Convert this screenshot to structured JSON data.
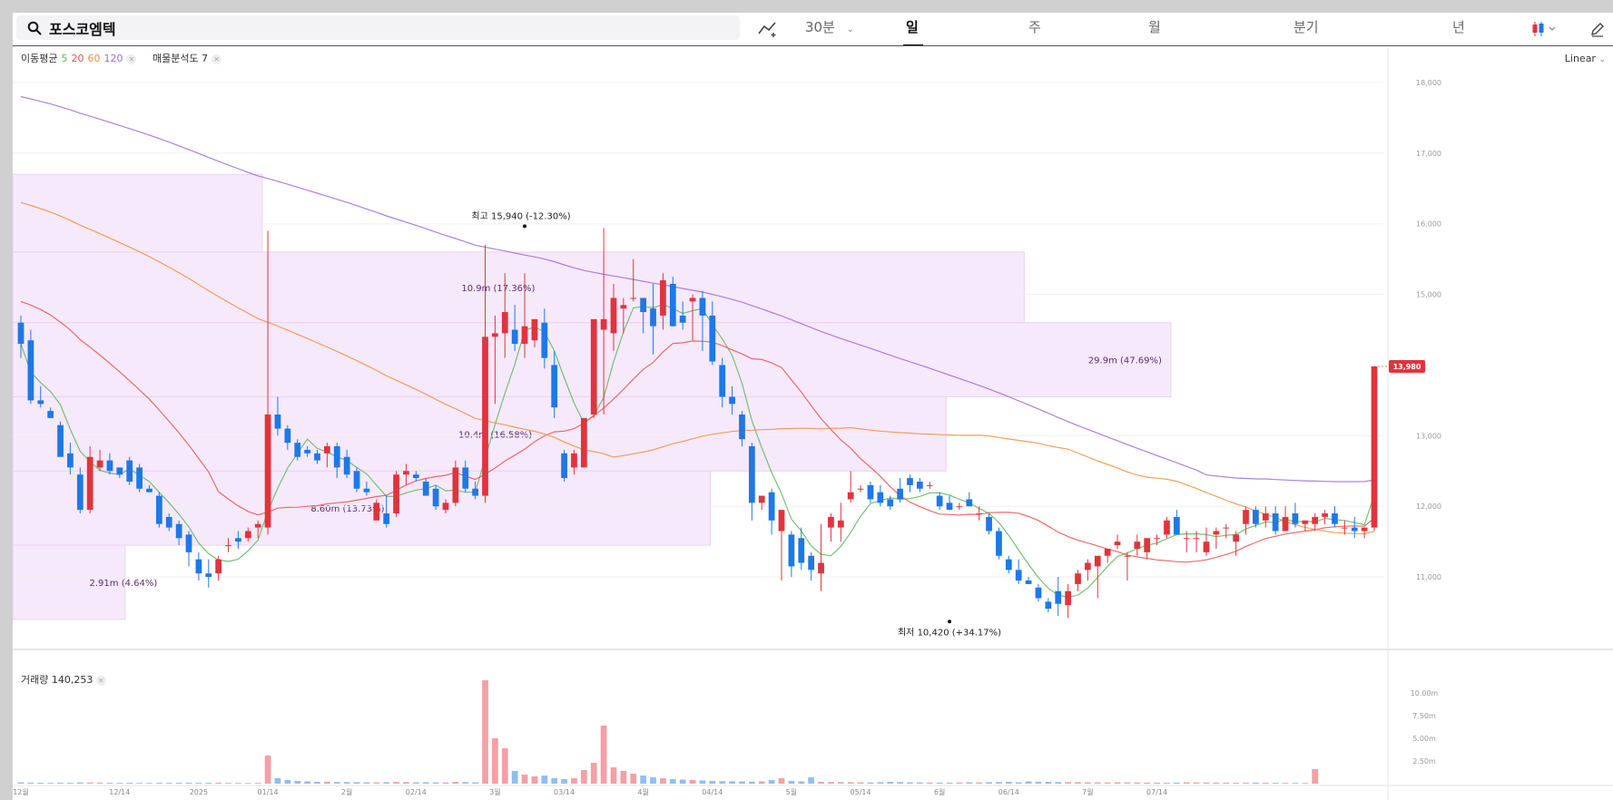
{
  "toolbar": {
    "search_value": "포스코엠텍",
    "interval": "30분",
    "tabs": [
      "일",
      "주",
      "월",
      "분기",
      "년"
    ],
    "active_tab": "일"
  },
  "legend": {
    "ma_label": "이동평균",
    "ma_periods": [
      {
        "label": "5",
        "color": "#5cb85c"
      },
      {
        "label": "20",
        "color": "#e9534f"
      },
      {
        "label": "60",
        "color": "#f0913e"
      },
      {
        "label": "120",
        "color": "#a06ad8"
      }
    ],
    "vp_label": "매물분석도 7",
    "volume_label": "거래량 140,253",
    "scale_mode": "Linear"
  },
  "colors": {
    "up": "#e0343d",
    "down": "#1e78e6",
    "vol_up": "#f4a0a5",
    "vol_down": "#8fbff2",
    "profile": "#f6e9fb"
  },
  "chart_data": {
    "type": "candlestick",
    "ylim": [
      10000,
      18500
    ],
    "y_ticks": [
      "18,000",
      "17,000",
      "16,000",
      "15,000",
      "13,000",
      "12,000",
      "11,000"
    ],
    "x_ticks": [
      "12월",
      "12/14",
      "2025",
      "01/14",
      "2월",
      "02/14",
      "3월",
      "03/14",
      "4월",
      "04/14",
      "5월",
      "05/14",
      "6월",
      "06/14",
      "7월",
      "07/14"
    ],
    "x_tick_index": [
      0,
      10,
      18,
      25,
      33,
      40,
      48,
      55,
      63,
      70,
      78,
      85,
      93,
      100,
      108,
      115
    ],
    "last_price_label": "13,980",
    "high_annotation": {
      "label": "최고 15,940 (-12.30%)",
      "index": 51,
      "value": 15940
    },
    "low_annotation": {
      "label": "최저 10,420 (+34.17%)",
      "index": 94,
      "value": 10420
    },
    "volume_ticks": [
      "10.00m",
      "7.50m",
      "5.00m",
      "2.50m"
    ],
    "volume_ylim": [
      0,
      12000000
    ],
    "ohlc": [
      [
        14600,
        14700,
        14100,
        14300
      ],
      [
        14350,
        14500,
        13450,
        13500
      ],
      [
        13500,
        13700,
        13400,
        13450
      ],
      [
        13350,
        13400,
        13300,
        13250
      ],
      [
        13150,
        13200,
        12850,
        12700
      ],
      [
        12750,
        12900,
        12450,
        12550
      ],
      [
        12450,
        12550,
        11900,
        11950
      ],
      [
        11950,
        12850,
        11900,
        12700
      ],
      [
        12550,
        12800,
        12500,
        12650
      ],
      [
        12650,
        12750,
        12450,
        12500
      ],
      [
        12550,
        12550,
        12400,
        12450
      ],
      [
        12650,
        12700,
        12300,
        12350
      ],
      [
        12550,
        12600,
        12200,
        12250
      ],
      [
        12250,
        12300,
        12200,
        12200
      ],
      [
        12150,
        12200,
        11700,
        11750
      ],
      [
        11850,
        11900,
        11650,
        11700
      ],
      [
        11750,
        11800,
        11450,
        11550
      ],
      [
        11600,
        11650,
        11150,
        11350
      ],
      [
        11250,
        11350,
        10950,
        11050
      ],
      [
        11050,
        11250,
        10850,
        11000
      ],
      [
        11050,
        11300,
        10950,
        11250
      ],
      [
        11450,
        11550,
        11350,
        11450
      ],
      [
        11550,
        11650,
        11400,
        11500
      ],
      [
        11550,
        11700,
        11500,
        11650
      ],
      [
        11700,
        11800,
        11550,
        11750
      ],
      [
        11700,
        15900,
        11600,
        13300
      ],
      [
        13300,
        13550,
        13000,
        13100
      ],
      [
        13100,
        13150,
        12800,
        12900
      ],
      [
        12900,
        12950,
        12650,
        12700
      ],
      [
        12800,
        12850,
        12700,
        12750
      ],
      [
        12750,
        12800,
        12600,
        12650
      ],
      [
        12750,
        12900,
        12550,
        12850
      ],
      [
        12850,
        12900,
        12400,
        12550
      ],
      [
        12700,
        12800,
        12400,
        12450
      ],
      [
        12500,
        12550,
        12200,
        12250
      ],
      [
        12250,
        12350,
        12150,
        12200
      ],
      [
        11800,
        12100,
        11800,
        12050
      ],
      [
        11900,
        12150,
        11700,
        11750
      ],
      [
        11900,
        12500,
        11850,
        12450
      ],
      [
        12450,
        12600,
        12300,
        12500
      ],
      [
        12450,
        12500,
        12350,
        12400
      ],
      [
        12350,
        12400,
        12150,
        12150
      ],
      [
        12250,
        12300,
        11950,
        12000
      ],
      [
        11950,
        12100,
        11900,
        12050
      ],
      [
        12050,
        12650,
        12000,
        12550
      ],
      [
        12550,
        12650,
        12200,
        12250
      ],
      [
        12250,
        12350,
        12100,
        12150
      ],
      [
        12150,
        15700,
        12050,
        14400
      ],
      [
        14400,
        14700,
        13450,
        14450
      ],
      [
        14450,
        15300,
        14100,
        14750
      ],
      [
        14500,
        14850,
        14200,
        14300
      ],
      [
        14300,
        15300,
        14100,
        14550
      ],
      [
        14350,
        14650,
        14250,
        14650
      ],
      [
        14600,
        14800,
        13950,
        14100
      ],
      [
        14000,
        14200,
        13250,
        13400
      ],
      [
        12750,
        12800,
        12350,
        12400
      ],
      [
        12550,
        12800,
        12450,
        12750
      ],
      [
        12550,
        13250,
        13200,
        13250
      ],
      [
        13300,
        14550,
        13250,
        14650
      ],
      [
        14500,
        15940,
        13300,
        14650
      ],
      [
        14450,
        15150,
        14200,
        14950
      ],
      [
        14800,
        14950,
        14450,
        14850
      ],
      [
        14950,
        15500,
        14900,
        14950
      ],
      [
        14950,
        14950,
        14450,
        14750
      ],
      [
        14800,
        15150,
        14150,
        14550
      ],
      [
        14700,
        15300,
        14500,
        15200
      ],
      [
        15150,
        15250,
        14550,
        14550
      ],
      [
        14700,
        14900,
        14500,
        14600
      ],
      [
        14900,
        15000,
        14350,
        14950
      ],
      [
        14950,
        15050,
        14200,
        14700
      ],
      [
        14700,
        14900,
        14000,
        14050
      ],
      [
        14000,
        14100,
        13400,
        13550
      ],
      [
        13550,
        13700,
        13300,
        13450
      ],
      [
        13300,
        13350,
        12850,
        12950
      ],
      [
        12850,
        12900,
        11800,
        12050
      ],
      [
        12050,
        12150,
        11950,
        12150
      ],
      [
        12200,
        12250,
        11600,
        11800
      ],
      [
        11650,
        11950,
        10950,
        11950
      ],
      [
        11600,
        11650,
        11000,
        11150
      ],
      [
        11550,
        11700,
        11100,
        11200
      ],
      [
        11300,
        11350,
        10950,
        11100
      ],
      [
        11050,
        11750,
        10800,
        11200
      ],
      [
        11700,
        11900,
        11500,
        11850
      ],
      [
        11700,
        12050,
        11500,
        11800
      ],
      [
        12100,
        12500,
        12050,
        12200
      ],
      [
        12250,
        12300,
        12200,
        12250
      ],
      [
        12300,
        12350,
        12050,
        12100
      ],
      [
        12200,
        12300,
        12000,
        12050
      ],
      [
        12100,
        12150,
        11950,
        12000
      ],
      [
        12250,
        12400,
        12050,
        12100
      ],
      [
        12400,
        12450,
        12200,
        12300
      ],
      [
        12350,
        12400,
        12200,
        12250
      ],
      [
        12300,
        12350,
        12250,
        12300
      ],
      [
        12150,
        12200,
        11950,
        12000
      ],
      [
        12050,
        12150,
        11950,
        11950
      ],
      [
        12000,
        12050,
        11950,
        12000
      ],
      [
        12100,
        12200,
        12000,
        12000
      ],
      [
        11900,
        12000,
        11800,
        11900
      ],
      [
        11850,
        11900,
        11600,
        11650
      ],
      [
        11650,
        11700,
        11250,
        11300
      ],
      [
        11250,
        11300,
        11050,
        11100
      ],
      [
        11100,
        11250,
        10900,
        10950
      ],
      [
        10950,
        11000,
        10900,
        10900
      ],
      [
        10850,
        10900,
        10650,
        10700
      ],
      [
        10650,
        10700,
        10500,
        10550
      ],
      [
        10800,
        11000,
        10450,
        10620
      ],
      [
        10600,
        10900,
        10420,
        10800
      ],
      [
        10900,
        11100,
        10800,
        11050
      ],
      [
        11100,
        11250,
        10950,
        11200
      ],
      [
        11150,
        11300,
        10700,
        11300
      ],
      [
        11300,
        11400,
        11200,
        11400
      ],
      [
        11450,
        11600,
        11400,
        11500
      ],
      [
        11300,
        11350,
        10950,
        11300
      ],
      [
        11400,
        11600,
        11300,
        11500
      ],
      [
        11350,
        11550,
        11250,
        11550
      ],
      [
        11550,
        11600,
        11450,
        11550
      ],
      [
        11600,
        11850,
        11550,
        11800
      ],
      [
        11850,
        11950,
        11600,
        11600
      ],
      [
        11550,
        11650,
        11350,
        11550
      ],
      [
        11550,
        11650,
        11350,
        11550
      ],
      [
        11350,
        11700,
        11300,
        11500
      ],
      [
        11600,
        11700,
        11400,
        11650
      ],
      [
        11700,
        11750,
        11550,
        11700
      ],
      [
        11500,
        11650,
        11300,
        11600
      ],
      [
        11750,
        12000,
        11600,
        11950
      ],
      [
        11950,
        12000,
        11700,
        11750
      ],
      [
        11800,
        12000,
        11700,
        11900
      ],
      [
        11900,
        12000,
        11600,
        11650
      ],
      [
        11650,
        12000,
        11650,
        11850
      ],
      [
        11900,
        12050,
        11700,
        11750
      ],
      [
        11750,
        11800,
        11650,
        11800
      ],
      [
        11750,
        11900,
        11650,
        11850
      ],
      [
        11850,
        11950,
        11750,
        11900
      ],
      [
        11900,
        12000,
        11700,
        11750
      ],
      [
        11700,
        11800,
        11600,
        11700
      ],
      [
        11700,
        11850,
        11550,
        11650
      ],
      [
        11650,
        11700,
        11550,
        11700
      ],
      [
        11700,
        13980,
        11650,
        13980
      ]
    ],
    "volume": [
      150000,
      120000,
      100000,
      90000,
      110000,
      95000,
      140000,
      130000,
      110000,
      95000,
      90000,
      100000,
      85000,
      80000,
      95000,
      90000,
      100000,
      110000,
      95000,
      100000,
      120000,
      90000,
      85000,
      80000,
      90000,
      3100000,
      600000,
      400000,
      300000,
      250000,
      200000,
      220000,
      180000,
      170000,
      160000,
      150000,
      140000,
      160000,
      190000,
      170000,
      150000,
      160000,
      140000,
      130000,
      200000,
      180000,
      150000,
      11400000,
      5000000,
      3900000,
      1400000,
      1000000,
      800000,
      900000,
      600000,
      500000,
      600000,
      1500000,
      2300000,
      6400000,
      1800000,
      1400000,
      1100000,
      900000,
      700000,
      600000,
      500000,
      450000,
      400000,
      350000,
      300000,
      280000,
      260000,
      240000,
      220000,
      250000,
      400000,
      600000,
      300000,
      250000,
      700000,
      200000,
      180000,
      170000,
      160000,
      150000,
      140000,
      160000,
      200000,
      180000,
      150000,
      140000,
      130000,
      120000,
      110000,
      130000,
      150000,
      140000,
      160000,
      180000,
      200000,
      150000,
      250000,
      220000,
      200000,
      180000,
      170000,
      160000,
      150000,
      140000,
      130000,
      150000,
      140000,
      130000,
      120000,
      110000,
      100000,
      120000,
      150000,
      140000,
      130000,
      120000,
      110000,
      100000,
      110000,
      120000,
      100000,
      95000,
      90000,
      85000,
      80000,
      1600000
    ],
    "volume_profile": [
      {
        "price_high": 16700,
        "price_low": 15600,
        "extent": 0.182,
        "label": ""
      },
      {
        "price_high": 15600,
        "price_low": 14600,
        "extent": 0.738,
        "label": "10.9m (17.36%)"
      },
      {
        "price_high": 14600,
        "price_low": 13550,
        "extent": 0.845,
        "label": "29.9m (47.69%)"
      },
      {
        "price_high": 13550,
        "price_low": 12500,
        "extent": 0.681,
        "label": "10.4m (16.58%)"
      },
      {
        "price_high": 12500,
        "price_low": 11450,
        "extent": 0.509,
        "label": "8.60m (13.73%)"
      },
      {
        "price_high": 11450,
        "price_low": 10400,
        "extent": 0.082,
        "label": "2.91m (4.64%)"
      }
    ]
  }
}
